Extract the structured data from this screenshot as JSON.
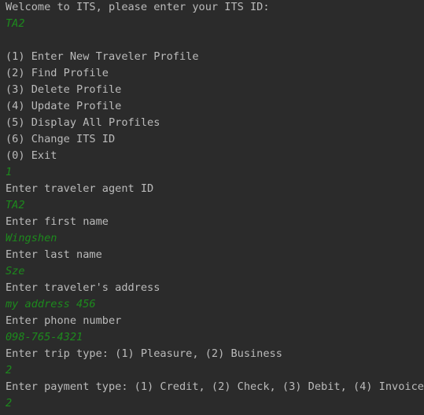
{
  "console": {
    "lines": [
      {
        "kind": "output",
        "text": "Welcome to ITS, please enter your ITS ID:"
      },
      {
        "kind": "input",
        "text": "TA2"
      },
      {
        "kind": "blank",
        "text": ""
      },
      {
        "kind": "output",
        "text": "(1) Enter New Traveler Profile"
      },
      {
        "kind": "output",
        "text": "(2) Find Profile"
      },
      {
        "kind": "output",
        "text": "(3) Delete Profile"
      },
      {
        "kind": "output",
        "text": "(4) Update Profile"
      },
      {
        "kind": "output",
        "text": "(5) Display All Profiles"
      },
      {
        "kind": "output",
        "text": "(6) Change ITS ID"
      },
      {
        "kind": "output",
        "text": "(0) Exit"
      },
      {
        "kind": "input",
        "text": "1"
      },
      {
        "kind": "output",
        "text": "Enter traveler agent ID"
      },
      {
        "kind": "input",
        "text": "TA2"
      },
      {
        "kind": "output",
        "text": "Enter first name"
      },
      {
        "kind": "input",
        "text": "Wingshen"
      },
      {
        "kind": "output",
        "text": "Enter last name"
      },
      {
        "kind": "input",
        "text": "Sze"
      },
      {
        "kind": "output",
        "text": "Enter traveler's address"
      },
      {
        "kind": "input",
        "text": "my address 456"
      },
      {
        "kind": "output",
        "text": "Enter phone number"
      },
      {
        "kind": "input",
        "text": "098-765-4321"
      },
      {
        "kind": "output",
        "text": "Enter trip type: (1) Pleasure, (2) Business"
      },
      {
        "kind": "input",
        "text": "2"
      },
      {
        "kind": "output",
        "text": "Enter payment type: (1) Credit, (2) Check, (3) Debit, (4) Invoice"
      },
      {
        "kind": "input",
        "text": "2"
      }
    ]
  },
  "colors": {
    "background": "#2b2b2b",
    "output_text": "#bbbbbb",
    "input_text": "#1d8a1d"
  }
}
